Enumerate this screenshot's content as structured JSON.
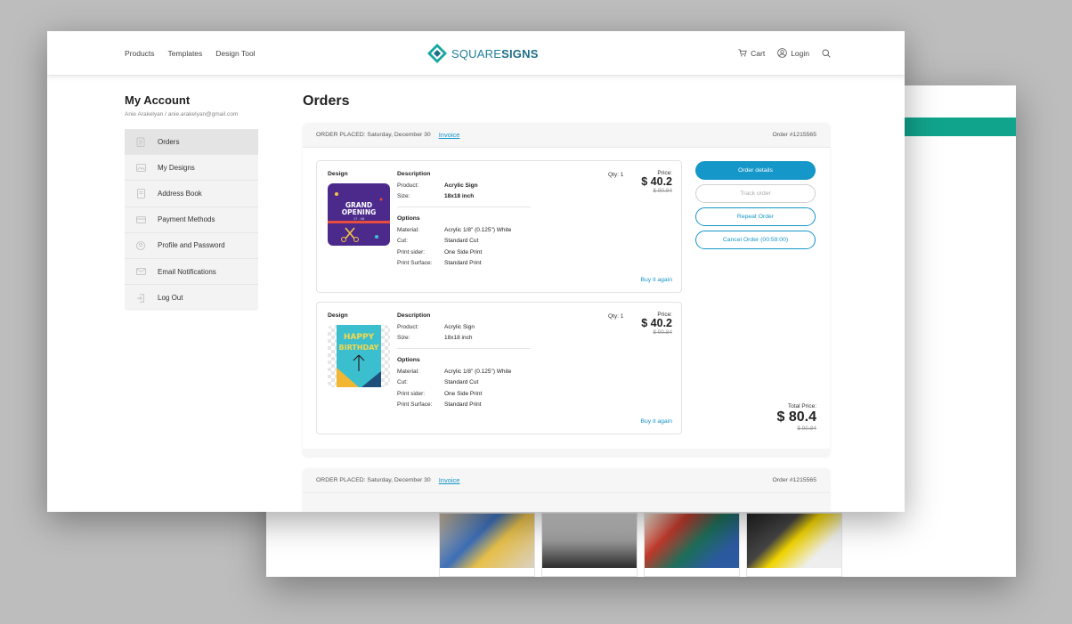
{
  "brand": {
    "name_light": "SQUARE",
    "name_bold": "SIGNS"
  },
  "nav": {
    "links": [
      "Products",
      "Templates",
      "Design Tool"
    ],
    "cart": "Cart",
    "login": "Login"
  },
  "sidebar": {
    "title": "My Account",
    "user": "Anie Arakelyan / anie.arakelyan@gmail.com",
    "items": [
      {
        "label": "Orders",
        "icon": "clipboard-icon"
      },
      {
        "label": "My Designs",
        "icon": "image-icon"
      },
      {
        "label": "Address Book",
        "icon": "book-icon"
      },
      {
        "label": "Payment Methods",
        "icon": "credit-card-icon"
      },
      {
        "label": "Profile and Password",
        "icon": "user-icon"
      },
      {
        "label": "Email Notifications",
        "icon": "envelope-icon"
      },
      {
        "label": "Log Out",
        "icon": "logout-icon"
      }
    ]
  },
  "page": {
    "title": "Orders"
  },
  "orders": [
    {
      "placed": "ORDER PLACED: Saturday, December 30",
      "invoice": "Invoice",
      "order_no": "Order  #1215565",
      "items": [
        {
          "design_label": "Design",
          "desc_label": "Description",
          "product_key": "Product:",
          "product": "Acrylic Sign",
          "size_key": "Size:",
          "size": "18x18 inch",
          "options_label": "Options",
          "material_key": "Material:",
          "material": "Acrylic 1/8\" (0.125\") White",
          "cut_key": "Cut:",
          "cut": "Standard Cut",
          "print_sider_key": "Print sider:",
          "print_sider": "One Side Print",
          "print_surface_key": "Print Surface:",
          "print_surface": "Standard Print",
          "qty": "Qty: 1",
          "price_label": "Price:",
          "price": "$ 40.2",
          "old_price": "$ 90.84",
          "buy_again": "Buy it again",
          "thumb_text": [
            "GRAND",
            "OPENING",
            "17 . 08"
          ]
        },
        {
          "design_label": "Design",
          "desc_label": "Description",
          "product_key": "Product:",
          "product": "Acrylic Sign",
          "size_key": "Size:",
          "size": "18x18 inch",
          "options_label": "Options",
          "material_key": "Material:",
          "material": "Acrylic 1/8\" (0.125\") White",
          "cut_key": "Cut:",
          "cut": "Standard Cut",
          "print_sider_key": "Print sider:",
          "print_sider": "One Side Print",
          "print_surface_key": "Print Surface:",
          "print_surface": "Standard Print",
          "qty": "Qty: 1",
          "price_label": "Price:",
          "price": "$ 40.2",
          "old_price": "$ 90.84",
          "buy_again": "Buy it again",
          "thumb_text": [
            "HAPPY",
            "BIRTHDAY"
          ]
        }
      ],
      "actions": {
        "details": "Order details",
        "track": "Track order",
        "repeat": "Repeat Order",
        "cancel": "Cancel Order (00:59:00)"
      },
      "total_label": "Total Price:",
      "total": "$ 80.4",
      "total_old": "$ 90.84"
    },
    {
      "placed": "ORDER PLACED: Saturday, December 30",
      "invoice": "Invoice",
      "order_no": "Order  #1215565"
    }
  ],
  "colors": {
    "accent": "#1597c9",
    "teal": "#11a48c",
    "logo": "#1e7f9a"
  }
}
